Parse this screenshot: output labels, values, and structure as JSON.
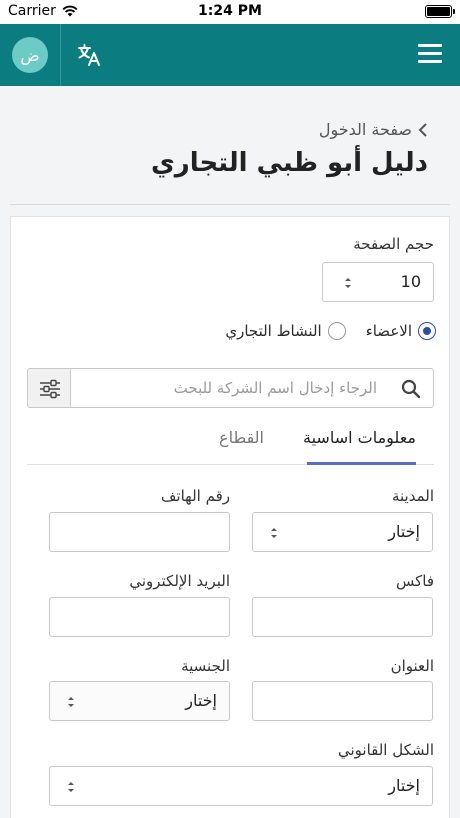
{
  "status_bar": {
    "carrier": "Carrier",
    "time": "1:24 PM"
  },
  "header": {
    "avatar_letter": "ض",
    "icons": [
      "translate-icon",
      "menu-icon"
    ]
  },
  "breadcrumb": {
    "label": "صفحة الدخول"
  },
  "page": {
    "title": "دليل أبو ظبي التجاري"
  },
  "page_size": {
    "label": "حجم الصفحة",
    "value": "10"
  },
  "filters": {
    "radio_options": [
      {
        "label": "الاعضاء",
        "checked": true
      },
      {
        "label": "النشاط التجاري",
        "checked": false
      }
    ],
    "search_placeholder": "الرجاء إدخال اسم الشركة للبحث"
  },
  "tabs": [
    {
      "label": "معلومات اساسية",
      "active": true
    },
    {
      "label": "القطاع",
      "active": false
    }
  ],
  "form": {
    "city_label": "المدينة",
    "city_value": "إختار",
    "phone_label": "رقم الهاتف",
    "phone_value": "",
    "fax_label": "فاكس",
    "fax_value": "",
    "email_label": "البريد الإلكتروني",
    "email_value": "",
    "address_label": "العنوان",
    "address_value": "",
    "nationality_label": "الجنسية",
    "nationality_value": "إختار",
    "legal_form_label": "الشكل القانوني",
    "legal_form_value": "إختار"
  },
  "colors": {
    "header_bg": "#0b7c80",
    "avatar_bg": "#6ccbc5",
    "accent": "#2b4fa2",
    "tab_indicator": "#5a6fbf"
  }
}
